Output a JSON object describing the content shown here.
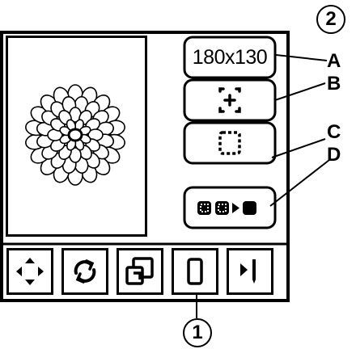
{
  "callouts": {
    "top_number": "2",
    "bottom_number": "1",
    "letters": [
      "A",
      "B",
      "C",
      "D"
    ]
  },
  "buttons": {
    "size_label": "180x130",
    "center_icon": "center-position-icon",
    "trace_icon": "trace-outline-icon",
    "stitch_sequence_icon": "stitch-sequence-icon"
  },
  "toolbar": {
    "items": [
      {
        "icon": "move-arrows-icon"
      },
      {
        "icon": "rotate-icon"
      },
      {
        "icon": "resize-icon"
      },
      {
        "icon": "hoop-icon",
        "selected": true
      },
      {
        "icon": "next-stitch-icon"
      }
    ]
  },
  "colors": {
    "ink": "#000000",
    "background": "#ffffff"
  }
}
